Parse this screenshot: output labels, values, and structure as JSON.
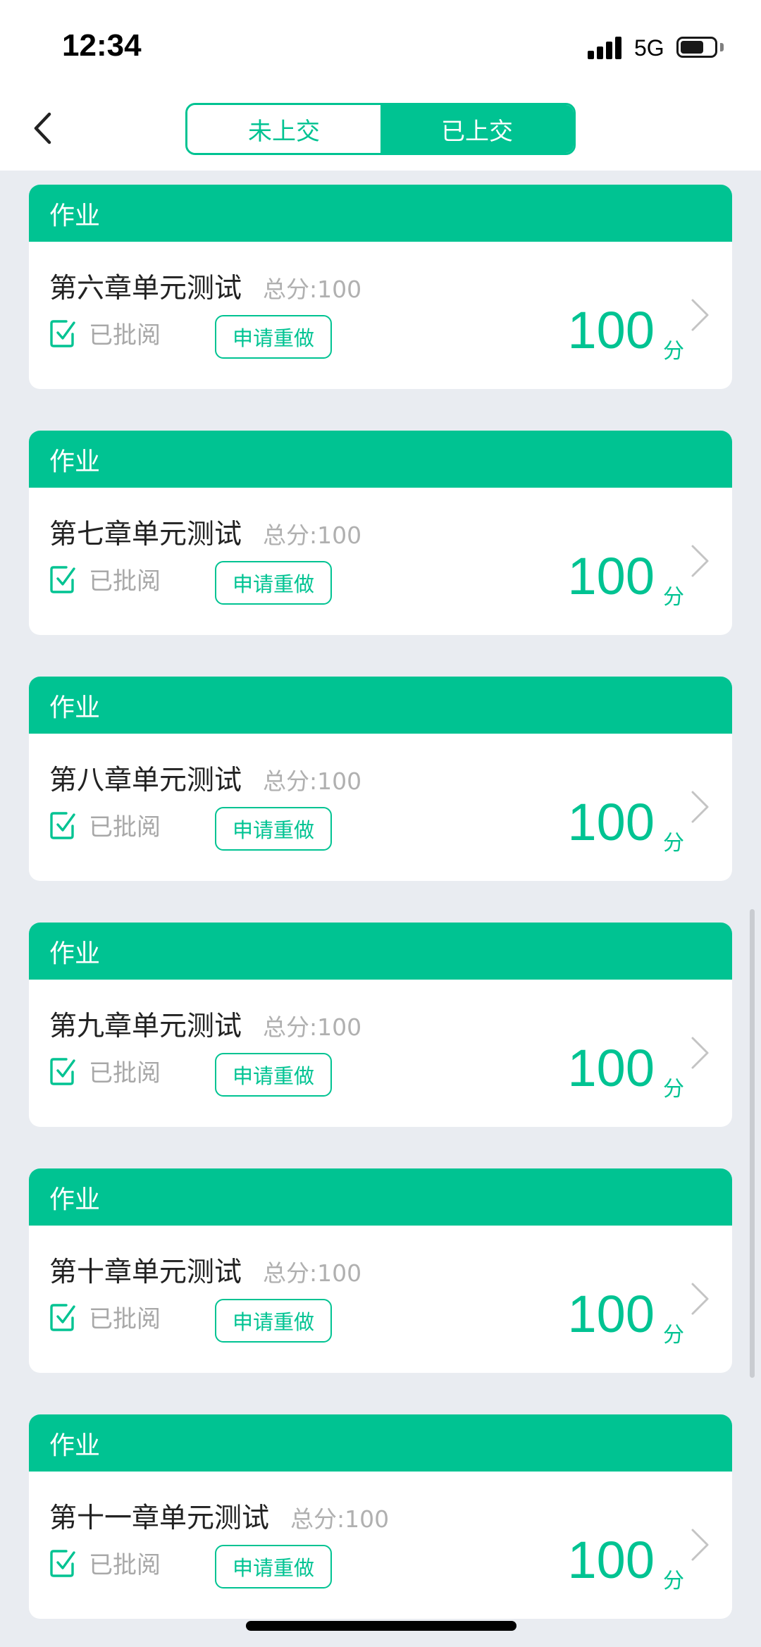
{
  "status_bar": {
    "time": "12:34",
    "network": "5G",
    "icons": [
      "signal-icon",
      "battery-icon"
    ]
  },
  "nav": {
    "back_icon": "chevron-left-icon",
    "tabs": [
      {
        "label": "未上交",
        "active": false
      },
      {
        "label": "已上交",
        "active": true
      }
    ]
  },
  "colors": {
    "accent": "#00c392",
    "page_bg": "#e9ecf1",
    "muted_text": "#a8a8a8"
  },
  "assignments": [
    {
      "type": "作业",
      "title": "第六章单元测试",
      "total": "总分:100",
      "status": "已批阅",
      "action": "申请重做",
      "score": "100",
      "unit": "分"
    },
    {
      "type": "作业",
      "title": "第七章单元测试",
      "total": "总分:100",
      "status": "已批阅",
      "action": "申请重做",
      "score": "100",
      "unit": "分"
    },
    {
      "type": "作业",
      "title": "第八章单元测试",
      "total": "总分:100",
      "status": "已批阅",
      "action": "申请重做",
      "score": "100",
      "unit": "分"
    },
    {
      "type": "作业",
      "title": "第九章单元测试",
      "total": "总分:100",
      "status": "已批阅",
      "action": "申请重做",
      "score": "100",
      "unit": "分"
    },
    {
      "type": "作业",
      "title": "第十章单元测试",
      "total": "总分:100",
      "status": "已批阅",
      "action": "申请重做",
      "score": "100",
      "unit": "分"
    },
    {
      "type": "作业",
      "title": "第十一章单元测试",
      "total": "总分:100",
      "status": "已批阅",
      "action": "申请重做",
      "score": "100",
      "unit": "分"
    }
  ]
}
